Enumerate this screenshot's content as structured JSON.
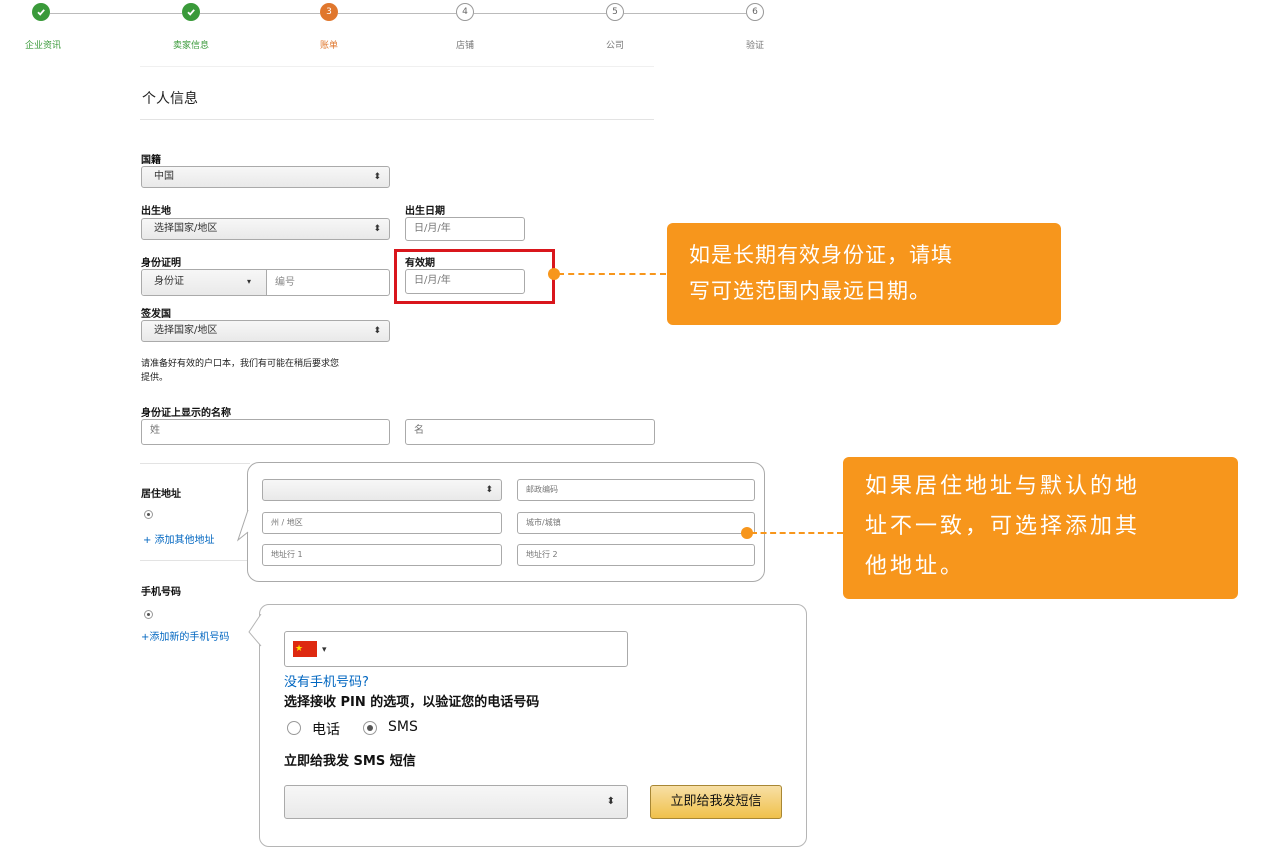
{
  "stepper": {
    "steps": [
      {
        "label": "企业资讯",
        "status": "done"
      },
      {
        "label": "卖家信息",
        "status": "done"
      },
      {
        "label": "账单",
        "number": "3",
        "status": "active"
      },
      {
        "label": "店铺",
        "number": "4",
        "status": "todo"
      },
      {
        "label": "公司",
        "number": "5",
        "status": "todo"
      },
      {
        "label": "验证",
        "number": "6",
        "status": "todo"
      }
    ]
  },
  "personal": {
    "title": "个人信息",
    "nationality": {
      "label": "国籍",
      "value": "中国"
    },
    "birthplace": {
      "label": "出生地",
      "value": "选择国家/地区"
    },
    "birth_date": {
      "label": "出生日期",
      "placeholder": "日/月/年"
    },
    "id_proof": {
      "label": "身份证明",
      "type_value": "身份证",
      "number_placeholder": "编号"
    },
    "expiry": {
      "label": "有效期",
      "placeholder": "日/月/年"
    },
    "issuing_country": {
      "label": "签发国",
      "value": "选择国家/地区"
    },
    "help_text_line1": "请准备好有效的户口本，我们有可能在稍后要求您",
    "help_text_line2": "提供。",
    "id_name": {
      "label": "身份证上显示的名称",
      "surname_placeholder": "姓",
      "given_placeholder": "名"
    }
  },
  "address": {
    "label": "居住地址",
    "add_link": "+ 添加其他地址",
    "country_value": "",
    "postcode_placeholder": "邮政编码",
    "state_placeholder": "州 / 地区",
    "city_placeholder": "城市/城镇",
    "line1_placeholder": "地址行 1",
    "line2_placeholder": "地址行 2"
  },
  "phone": {
    "label": "手机号码",
    "add_link": "+添加新的手机号码",
    "no_phone_link": "没有手机号码?",
    "pin_heading": "选择接收 PIN 的选项，以验证您的电话号码",
    "option_call": "电话",
    "option_sms": "SMS",
    "selected_option": "SMS",
    "sms_heading": "立即给我发 SMS 短信",
    "sms_select_value": "",
    "sms_button": "立即给我发短信"
  },
  "callouts": {
    "expiry_line1": "如是长期有效身份证，请填",
    "expiry_line2": "写可选范围内最远日期。",
    "address_line1": "如果居住地址与默认的地",
    "address_line2": "址不一致，可选择添加其",
    "address_line3": "他地址。"
  },
  "colors": {
    "step_done": "#3a9a3a",
    "step_active": "#e0772d",
    "callout": "#f7961c",
    "highlight": "#d9161c",
    "link": "#0066c0"
  }
}
